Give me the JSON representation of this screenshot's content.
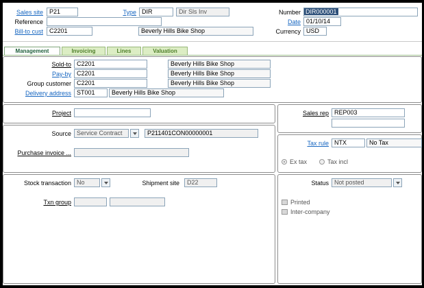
{
  "header": {
    "sales_site": {
      "label": "Sales site",
      "value": "P21"
    },
    "type": {
      "label": "Type",
      "code": "DIR",
      "desc": "Dir Sls Inv"
    },
    "number": {
      "label": "Number",
      "value": "DIR000001"
    },
    "reference": {
      "label": "Reference",
      "value": ""
    },
    "date": {
      "label": "Date",
      "value": "01/10/14"
    },
    "bill_to": {
      "label": "Bill-to cust",
      "code": "C2201",
      "name": "Beverly Hills Bike Shop"
    },
    "currency": {
      "label": "Currency",
      "value": "USD"
    }
  },
  "tabs": [
    {
      "label": "Management",
      "active": true
    },
    {
      "label": "Invoicing",
      "active": false
    },
    {
      "label": "Lines",
      "active": false
    },
    {
      "label": "Valuation",
      "active": false
    }
  ],
  "customer": {
    "sold_to": {
      "label": "Sold-to",
      "code": "C2201",
      "name": "Beverly Hills Bike Shop"
    },
    "pay_by": {
      "label": "Pay-by",
      "code": "C2201",
      "name": "Beverly Hills Bike Shop"
    },
    "group_customer": {
      "label": "Group customer",
      "code": "C2201",
      "name": "Beverly Hills Bike Shop"
    },
    "delivery_address": {
      "label": "Delivery address",
      "code": "ST001",
      "name": "Beverly Hills Bike Shop"
    }
  },
  "project": {
    "label": "Project",
    "value": ""
  },
  "sales_rep": {
    "label": "Sales rep",
    "value": "REP003",
    "value2": ""
  },
  "source": {
    "label": "Source",
    "selected": "Service Contract",
    "ref": "P211401CON00000001"
  },
  "purchase_invoice": {
    "label": "Purchase invoice ...",
    "value": ""
  },
  "tax_rule": {
    "label": "Tax rule",
    "code": "NTX",
    "desc": "No Tax"
  },
  "tax_mode": {
    "ex_tax": "Ex tax",
    "tax_incl": "Tax incl",
    "selected": "ex_tax"
  },
  "stock_transaction": {
    "label": "Stock transaction",
    "selected": "No"
  },
  "shipment_site": {
    "label": "Shipment site",
    "value": "D22"
  },
  "txn_group": {
    "label": "Txn group",
    "value1": "",
    "value2": ""
  },
  "status": {
    "label": "Status",
    "selected": "Not posted",
    "printed": "Printed",
    "inter_company": "Inter-company"
  }
}
